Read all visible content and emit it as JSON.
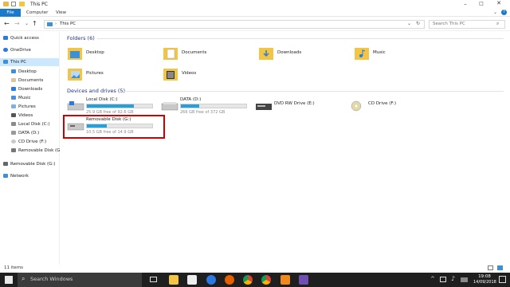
{
  "window": {
    "title": "This PC"
  },
  "ribbon": {
    "tabs": [
      "File",
      "Computer",
      "View"
    ]
  },
  "address": {
    "path": "This PC",
    "search_placeholder": "Search This PC"
  },
  "nav": {
    "quick_access": "Quick access",
    "onedrive": "OneDrive",
    "this_pc": "This PC",
    "items": [
      "Desktop",
      "Documents",
      "Downloads",
      "Music",
      "Pictures",
      "Videos",
      "Local Disk (C:)",
      "DATA (D:)",
      "CD Drive (F:)",
      "Removable Disk (G:)"
    ],
    "removable": "Removable Disk (G:)",
    "network": "Network"
  },
  "folders": {
    "header": "Folders (6)",
    "items": [
      "Desktop",
      "Documents",
      "Downloads",
      "Music",
      "Pictures",
      "Videos"
    ]
  },
  "devices": {
    "header": "Devices and drives (5)",
    "items": [
      {
        "name": "Local Disk (C:)",
        "free": "25.9 GB free of 92.6 GB",
        "used_fraction": 0.72
      },
      {
        "name": "DATA (D:)",
        "free": "266 GB free of 372 GB",
        "used_fraction": 0.28
      },
      {
        "name": "DVD RW Drive (E:)"
      },
      {
        "name": "CD Drive (F:)"
      },
      {
        "name": "Removable Disk (G:)",
        "free": "10.5 GB free of 14.9 GB",
        "used_fraction": 0.3
      }
    ]
  },
  "status": {
    "count": "11 items"
  },
  "taskbar": {
    "search": "Search Windows",
    "time": "19:08",
    "date": "14/09/2018"
  },
  "colors": {
    "accent": "#0078d7",
    "highlight": "#cc0000",
    "bar": "#26a0da"
  }
}
